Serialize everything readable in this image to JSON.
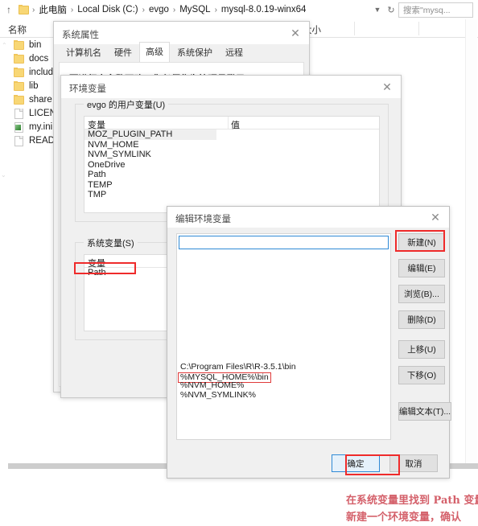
{
  "explorer": {
    "up_icon": "up-arrow-icon",
    "breadcrumbs": [
      "此电脑",
      "Local Disk (C:)",
      "evgo",
      "MySQL",
      "mysql-8.0.19-winx64"
    ],
    "separator": "›",
    "dropdown_icon": "chevron-down-icon",
    "refresh_icon": "refresh-icon",
    "search_placeholder": "搜索\"mysq...",
    "columns": {
      "name": "名称",
      "size": "大小"
    },
    "files": [
      {
        "name": "bin",
        "type": "folder"
      },
      {
        "name": "docs",
        "type": "folder"
      },
      {
        "name": "include",
        "type": "folder"
      },
      {
        "name": "lib",
        "type": "folder"
      },
      {
        "name": "share",
        "type": "folder"
      },
      {
        "name": "LICENSE",
        "type": "file"
      },
      {
        "name": "my.ini",
        "type": "ini"
      },
      {
        "name": "README",
        "type": "file"
      }
    ]
  },
  "system_properties": {
    "title": "系统属性",
    "close_icon": "close-icon",
    "tabs": [
      {
        "label": "计算机名",
        "active": false
      },
      {
        "label": "硬件",
        "active": false
      },
      {
        "label": "高级",
        "active": true
      },
      {
        "label": "系统保护",
        "active": false
      },
      {
        "label": "远程",
        "active": false
      }
    ],
    "note": "要进行大多数更改，你必须作为管理员登录。"
  },
  "environment_variables": {
    "title": "环境变量",
    "close_icon": "close-icon",
    "user_group_label": "evgo 的用户变量(U)",
    "system_group_label": "系统变量(S)",
    "columns": {
      "variable": "变量",
      "value": "值"
    },
    "user_variables": [
      {
        "name": "MOZ_PLUGIN_PATH",
        "value": "",
        "selected": true
      },
      {
        "name": "NVM_HOME",
        "value": "",
        "selected": false
      },
      {
        "name": "NVM_SYMLINK",
        "value": "",
        "selected": false
      },
      {
        "name": "OneDrive",
        "value": "",
        "selected": false
      },
      {
        "name": "Path",
        "value": "",
        "selected": false
      },
      {
        "name": "TEMP",
        "value": "",
        "selected": false
      },
      {
        "name": "TMP",
        "value": "",
        "selected": false
      }
    ],
    "system_variables": [
      {
        "name": "Path",
        "value": "",
        "highlighted": true
      }
    ]
  },
  "edit_environment_variable": {
    "title": "编辑环境变量",
    "close_icon": "close-icon",
    "editing_row_value": "",
    "entries": [
      {
        "text": "C:\\Program Files\\R\\R-3.5.1\\bin",
        "boxed": false
      },
      {
        "text": "%MYSQL_HOME%\\bin",
        "boxed": true
      },
      {
        "text": "%NVM_HOME%",
        "boxed": false
      },
      {
        "text": "%NVM_SYMLINK%",
        "boxed": false
      }
    ],
    "buttons": [
      {
        "label": "新建(N)",
        "highlighted": true
      },
      {
        "label": "编辑(E)",
        "highlighted": false
      },
      {
        "label": "浏览(B)...",
        "highlighted": false
      },
      {
        "label": "删除(D)",
        "highlighted": false
      },
      {
        "label": "上移(U)",
        "highlighted": false
      },
      {
        "label": "下移(O)",
        "highlighted": false
      },
      {
        "label": "编辑文本(T)...",
        "highlighted": false
      }
    ],
    "ok_label": "确定",
    "cancel_label": "取消"
  },
  "annotation": {
    "line1": "在系统变量里找到 Path 变量，",
    "line2": "新建一个环境变量，确认",
    "color": "#d4606a"
  },
  "accent": {
    "selection_blue": "#1b8ad6",
    "highlight_red": "#ef2b2b",
    "folder_yellow": "#f8d775"
  }
}
